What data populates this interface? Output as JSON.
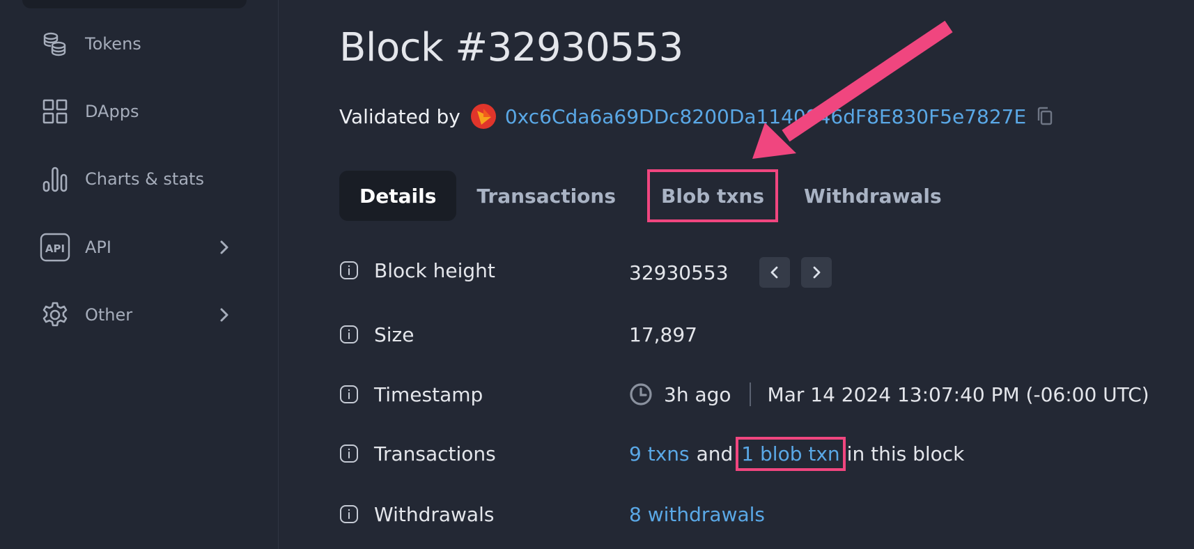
{
  "sidebar": {
    "items": [
      {
        "label": "Tokens",
        "icon": "coins-icon"
      },
      {
        "label": "DApps",
        "icon": "grid-icon"
      },
      {
        "label": "Charts & stats",
        "icon": "bar-chart-icon"
      },
      {
        "label": "API",
        "icon": "api-icon",
        "has_submenu": true
      },
      {
        "label": "Other",
        "icon": "gear-icon",
        "has_submenu": true
      }
    ]
  },
  "page": {
    "title": "Block #32930553",
    "validated_by_label": "Validated by",
    "validator_address": "0xc6Cda6a69DDc8200Da1140946dF8E830F5e7827E"
  },
  "tabs": [
    {
      "label": "Details",
      "active": true
    },
    {
      "label": "Transactions",
      "active": false
    },
    {
      "label": "Blob txns",
      "active": false,
      "highlighted": true
    },
    {
      "label": "Withdrawals",
      "active": false
    }
  ],
  "details": {
    "block_height": {
      "label": "Block height",
      "value": "32930553"
    },
    "size": {
      "label": "Size",
      "value": "17,897"
    },
    "timestamp": {
      "label": "Timestamp",
      "relative": "3h ago",
      "absolute": "Mar 14 2024 13:07:40 PM (-06:00 UTC)"
    },
    "transactions": {
      "label": "Transactions",
      "txns_link": "9 txns",
      "and_text": "and",
      "blob_link": "1 blob txn",
      "suffix": "in this block"
    },
    "withdrawals": {
      "label": "Withdrawals",
      "value_link": "8 withdrawals"
    }
  },
  "colors": {
    "background": "#232834",
    "link": "#5aa8e6",
    "highlight": "#f0467f",
    "active_tab_bg": "#191d25"
  }
}
